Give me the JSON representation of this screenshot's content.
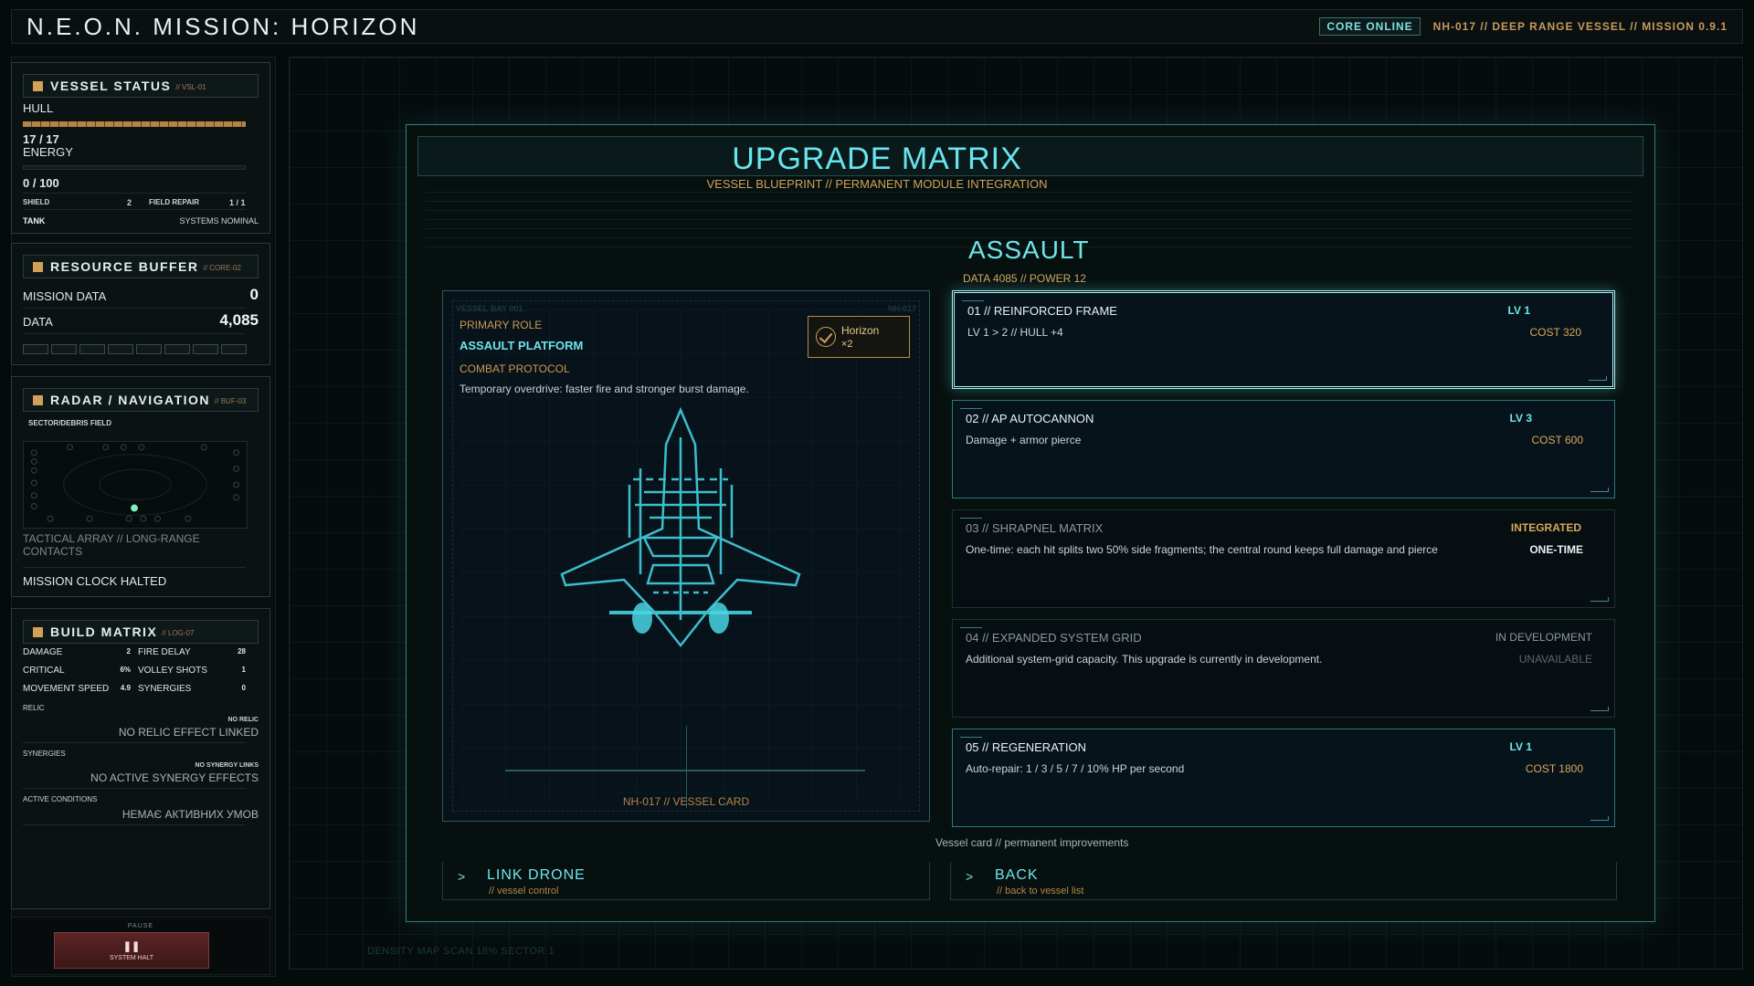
{
  "topbar": {
    "title": "N.E.O.N. MISSION: HORIZON",
    "core_badge": "CORE ONLINE",
    "vessel_info": "NH-017 // DEEP RANGE VESSEL // MISSION 0.9.1"
  },
  "vessel_status": {
    "title": "VESSEL STATUS",
    "tag": "// VSL-01",
    "hull_label": "HULL",
    "hull_value": "17 / 17",
    "hull_fraction": 1.0,
    "energy_label": "ENERGY",
    "energy_value": "0 / 100",
    "energy_fraction": 0.0,
    "shield_label": "SHIELD",
    "shield_value": "2",
    "repair_label": "FIELD REPAIR",
    "repair_value": "1 / 1",
    "class_label": "TANK",
    "systems": "SYSTEMS NOMINAL"
  },
  "resource_buffer": {
    "title": "RESOURCE BUFFER",
    "tag": "// CORE-02",
    "mission_data_label": "MISSION DATA",
    "mission_data_value": "0",
    "data_label": "DATA",
    "data_value": "4,085"
  },
  "radar": {
    "title": "RADAR / NAVIGATION",
    "tag": "// BUF-03",
    "sector": "SECTOR/DEBRIS FIELD",
    "array": "TACTICAL ARRAY // LONG-RANGE CONTACTS",
    "clock": "MISSION CLOCK HALTED"
  },
  "build_matrix": {
    "title": "BUILD MATRIX",
    "tag": "// LOG-07",
    "stats": [
      {
        "label": "DAMAGE",
        "value": "2"
      },
      {
        "label": "FIRE DELAY",
        "value": "28"
      },
      {
        "label": "CRITICAL",
        "value": "6%"
      },
      {
        "label": "VOLLEY SHOTS",
        "value": "1"
      },
      {
        "label": "MOVEMENT SPEED",
        "value": "4.9"
      },
      {
        "label": "SYNERGIES",
        "value": "0"
      }
    ],
    "relic_label": "RELIC",
    "relic_tag": "NO RELIC",
    "relic_text": "NO RELIC EFFECT LINKED",
    "synergies_label": "SYNERGIES",
    "synergies_tag": "NO SYNERGY LINKS",
    "synergies_text": "NO ACTIVE SYNERGY EFFECTS",
    "conditions_label": "ACTIVE CONDITIONS",
    "conditions_text": "НЕМАЄ АКТИВНИХ УМОВ"
  },
  "pause": {
    "label": "PAUSE",
    "icon": "pause-icon",
    "glyph": "❚❚",
    "button_text": "SYSTEM HALT"
  },
  "upgrade": {
    "title": "UPGRADE MATRIX",
    "subtitle": "VESSEL BLUEPRINT // PERMANENT MODULE INTEGRATION",
    "class_name": "ASSAULT",
    "stats": "DATA 4085  //  POWER 12",
    "card": {
      "ghost_left": "VESSEL BAY 001",
      "ghost_right": "NH-017",
      "role_label": "PRIMARY ROLE",
      "role": "ASSAULT PLATFORM",
      "protocol_label": "COMBAT PROTOCOL",
      "protocol": "Temporary overdrive: faster fire and stronger burst damage.",
      "badge_name": "Horizon",
      "badge_count": "×2",
      "footer": "NH-017 // VESSEL CARD"
    },
    "modules": [
      {
        "name": "01 // REINFORCED FRAME",
        "desc": "LV 1 > 2 // HULL +4",
        "level": "LV 1",
        "cost": "COST 320"
      },
      {
        "name": "02 // AP AUTOCANNON",
        "desc": "Damage + armor pierce",
        "level": "LV 3",
        "cost": "COST 600"
      },
      {
        "name": "03 // SHRAPNEL MATRIX",
        "desc": "One-time: each hit splits two 50% side fragments; the central round keeps full damage and pierce",
        "level": "INTEGRATED",
        "cost": "ONE-TIME"
      },
      {
        "name": "04 // EXPANDED SYSTEM GRID",
        "desc": "Additional system-grid capacity. This upgrade is currently in development.",
        "level": "IN DEVELOPMENT",
        "cost": "UNAVAILABLE"
      },
      {
        "name": "05 // REGENERATION",
        "desc": "Auto-repair: 1 / 3 / 5 / 7 / 10% HP per second",
        "level": "LV 1",
        "cost": "COST 1800"
      }
    ],
    "footnote": "Vessel card // permanent improvements",
    "actions": {
      "link_label": "LINK DRONE",
      "link_sub": "// vessel control",
      "back_label": "BACK",
      "back_sub": "// back to vessel list",
      "arrow": ">"
    }
  },
  "density": "DENSITY MAP  SCAN 18%  SECTOR 1",
  "colors": {
    "accent_cyan": "#6fe4ea",
    "accent_amber": "#d2a159",
    "pause_red": "#5a2424",
    "badge_green": "#6fe0a0"
  }
}
